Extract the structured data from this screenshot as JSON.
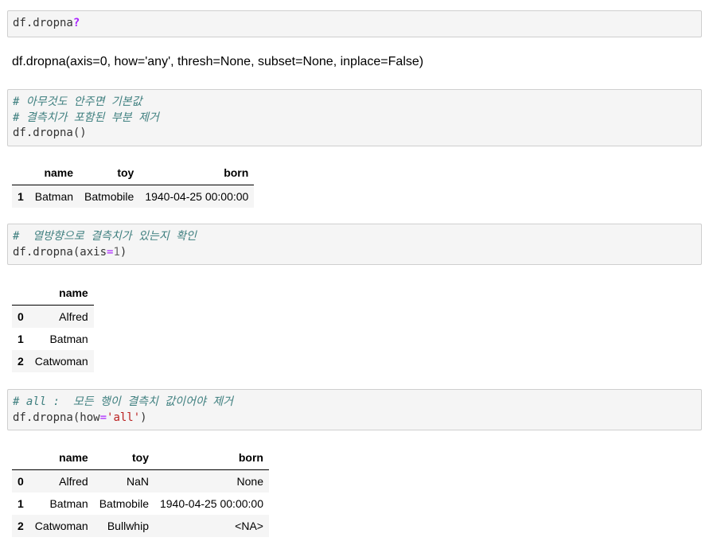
{
  "cell1": {
    "obj": "df.dropna",
    "op": "?"
  },
  "signature": "df.dropna(axis=0, how='any', thresh=None, subset=None, inplace=False)",
  "cell2": {
    "comment1": "# 아무것도 안주면 기본값",
    "comment2": "# 결측치가 포함된 부분 제거",
    "code": "df.dropna()"
  },
  "table1": {
    "columns": [
      "name",
      "toy",
      "born"
    ],
    "rows": [
      {
        "index": "1",
        "name": "Batman",
        "toy": "Batmobile",
        "born": "1940-04-25 00:00:00"
      }
    ]
  },
  "cell3": {
    "comment": "#  열방향으로 결측치가 있는지 확인",
    "code_pre": "df.dropna(axis",
    "eq": "=",
    "num": "1",
    "code_post": ")"
  },
  "table2": {
    "columns": [
      "name"
    ],
    "rows": [
      {
        "index": "0",
        "name": "Alfred"
      },
      {
        "index": "1",
        "name": "Batman"
      },
      {
        "index": "2",
        "name": "Catwoman"
      }
    ]
  },
  "cell4": {
    "comment": "# all :  모든 행이 결측치 값이어야 제거",
    "code_pre": "df.dropna(how",
    "eq": "=",
    "str": "'all'",
    "code_post": ")"
  },
  "table3": {
    "columns": [
      "name",
      "toy",
      "born"
    ],
    "rows": [
      {
        "index": "0",
        "name": "Alfred",
        "toy": "NaN",
        "born": "None"
      },
      {
        "index": "1",
        "name": "Batman",
        "toy": "Batmobile",
        "born": "1940-04-25 00:00:00"
      },
      {
        "index": "2",
        "name": "Catwoman",
        "toy": "Bullwhip",
        "born": "<NA>"
      }
    ]
  }
}
